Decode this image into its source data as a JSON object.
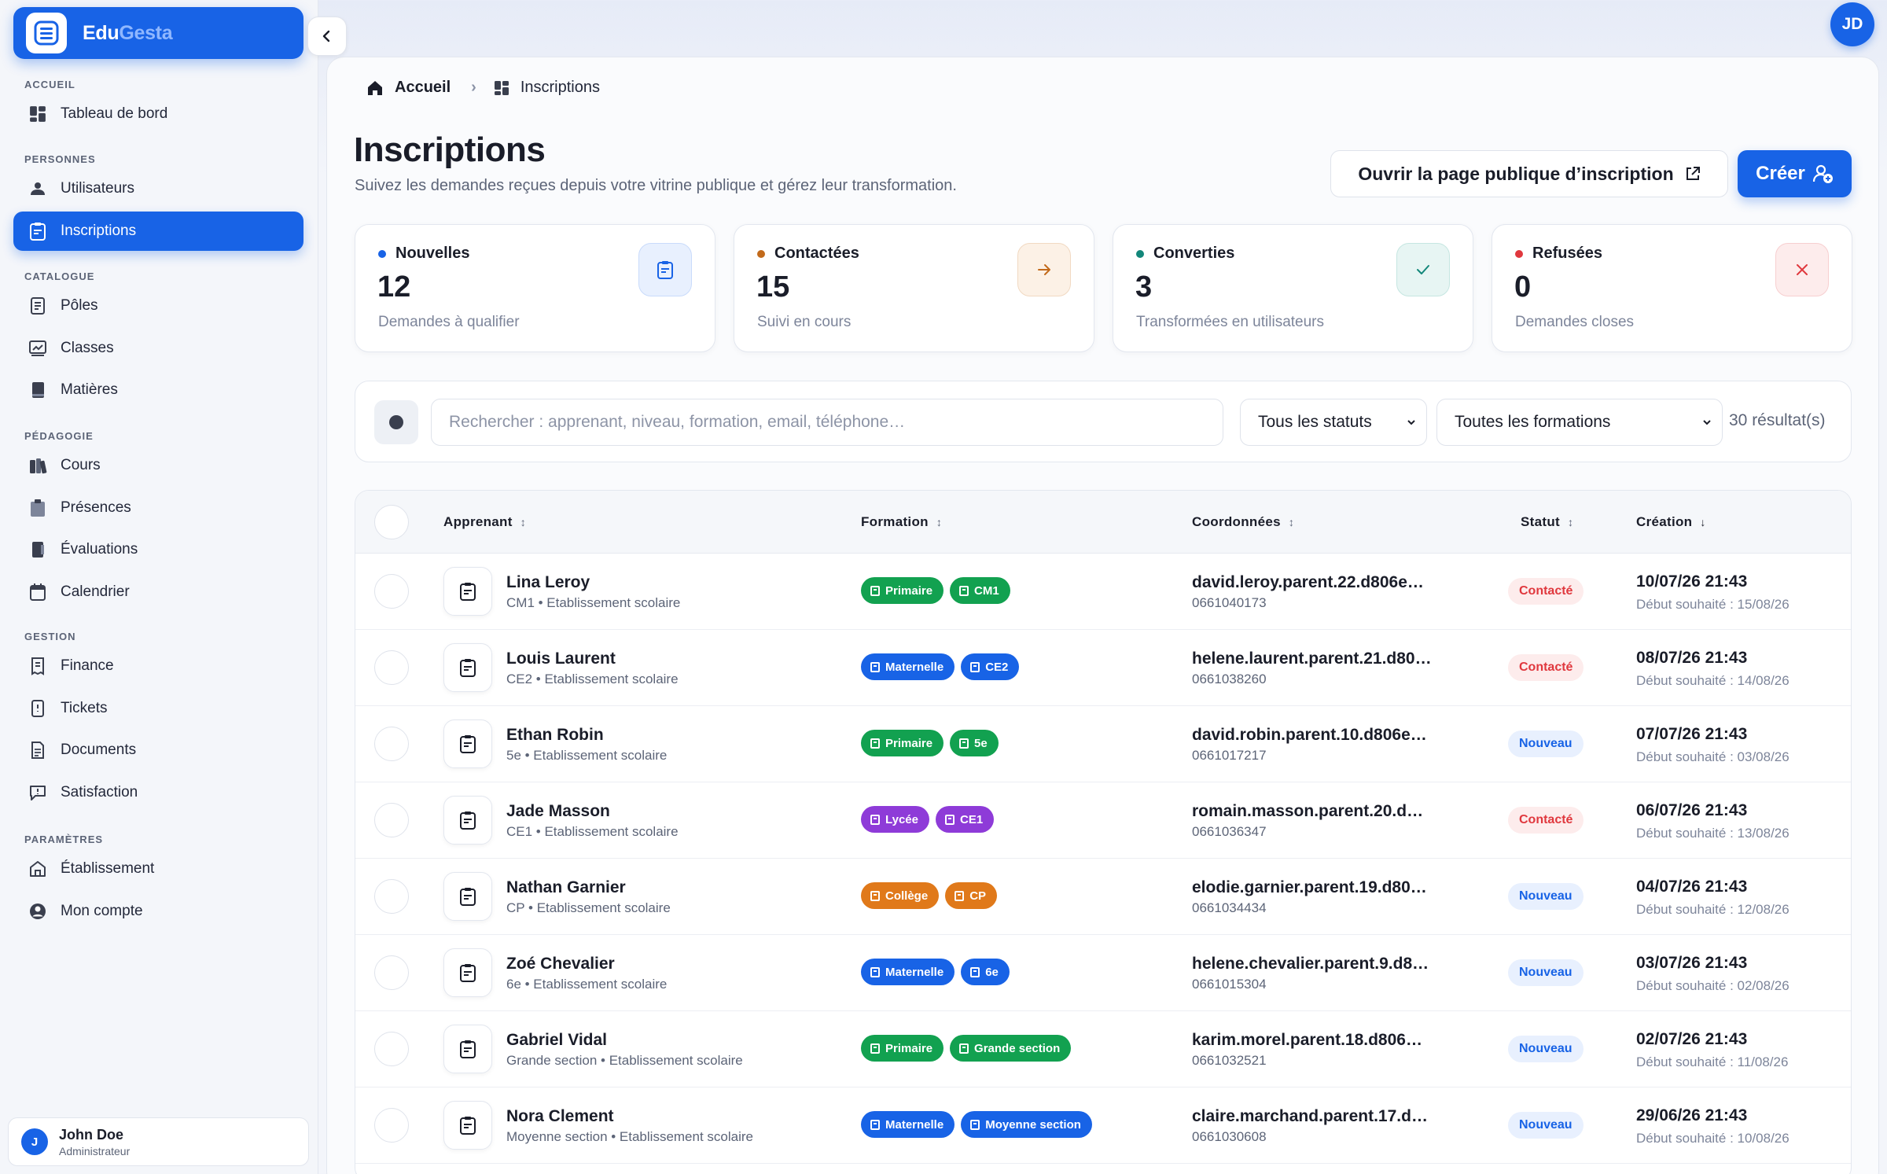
{
  "brand": {
    "name_part1": "Edu",
    "name_part2": "Gesta"
  },
  "top_avatar": "JD",
  "sidebar": {
    "sections": [
      {
        "label": "ACCUEIL",
        "items": [
          {
            "label": "Tableau de bord",
            "icon": "dashboard-icon"
          }
        ]
      },
      {
        "label": "PERSONNES",
        "items": [
          {
            "label": "Utilisateurs",
            "icon": "users-icon"
          },
          {
            "label": "Inscriptions",
            "icon": "clipboard-icon",
            "active": true
          }
        ]
      },
      {
        "label": "CATALOGUE",
        "items": [
          {
            "label": "Pôles",
            "icon": "document-icon"
          },
          {
            "label": "Classes",
            "icon": "classroom-icon"
          },
          {
            "label": "Matières",
            "icon": "book-icon"
          }
        ]
      },
      {
        "label": "PÉDAGOGIE",
        "items": [
          {
            "label": "Cours",
            "icon": "books-icon"
          },
          {
            "label": "Présences",
            "icon": "clipboard-check-icon"
          },
          {
            "label": "Évaluations",
            "icon": "notebook-icon"
          },
          {
            "label": "Calendrier",
            "icon": "calendar-icon"
          }
        ]
      },
      {
        "label": "GESTION",
        "items": [
          {
            "label": "Finance",
            "icon": "receipt-icon"
          },
          {
            "label": "Tickets",
            "icon": "ticket-icon"
          },
          {
            "label": "Documents",
            "icon": "file-icon"
          },
          {
            "label": "Satisfaction",
            "icon": "message-icon"
          }
        ]
      },
      {
        "label": "PARAMÈTRES",
        "items": [
          {
            "label": "Établissement",
            "icon": "building-icon"
          },
          {
            "label": "Mon compte",
            "icon": "account-icon"
          }
        ]
      }
    ],
    "user": {
      "initial": "J",
      "name": "John Doe",
      "role": "Administrateur"
    }
  },
  "breadcrumb": {
    "home": "Accueil",
    "current": "Inscriptions"
  },
  "page": {
    "title": "Inscriptions",
    "subtitle": "Suivez les demandes reçues depuis votre vitrine publique et gérez leur transformation."
  },
  "actions": {
    "public_page": "Ouvrir la page publique d’inscription",
    "create": "Créer"
  },
  "stats": [
    {
      "label": "Nouvelles",
      "value": "12",
      "desc": "Demandes à qualifier",
      "dot_color": "#1863e6",
      "icon": "clipboard-icon",
      "icon_color": "#1863e6",
      "icon_bg": "#e8f0fe",
      "icon_border": "#c9dbfb"
    },
    {
      "label": "Contactées",
      "value": "15",
      "desc": "Suivi en cours",
      "dot_color": "#c26a1b",
      "icon": "arrow-right-icon",
      "icon_color": "#c26a1b",
      "icon_bg": "#fcf1e6",
      "icon_border": "#f1d9c2"
    },
    {
      "label": "Converties",
      "value": "3",
      "desc": "Transformées en utilisateurs",
      "dot_color": "#13877a",
      "icon": "check-icon",
      "icon_color": "#13877a",
      "icon_bg": "#e7f5f3",
      "icon_border": "#c6e6e1"
    },
    {
      "label": "Refusées",
      "value": "0",
      "desc": "Demandes closes",
      "dot_color": "#e0383e",
      "icon": "close-icon",
      "icon_color": "#e0383e",
      "icon_bg": "#fdecec",
      "icon_border": "#f7cfd0"
    }
  ],
  "filters": {
    "search_placeholder": "Rechercher : apprenant, niveau, formation, email, téléphone…",
    "status_select": "Tous les statuts",
    "formation_select": "Toutes les formations",
    "result_count": "30 résultat(s)"
  },
  "table": {
    "headers": {
      "apprenant": "Apprenant",
      "formation": "Formation",
      "coordonnees": "Coordonnées",
      "statut": "Statut",
      "creation": "Création"
    },
    "rows": [
      {
        "name": "Lina Leroy",
        "sub": "CM1 • Etablissement scolaire",
        "tags": [
          {
            "label": "Primaire",
            "color": "#12a150"
          },
          {
            "label": "CM1",
            "color": "#12a150"
          }
        ],
        "email": "david.leroy.parent.22.d806e…",
        "phone": "0661040173",
        "status": "Contacté",
        "status_kind": "contacte",
        "date": "10/07/26 21:43",
        "desired": "Début souhaité : 15/08/26"
      },
      {
        "name": "Louis Laurent",
        "sub": "CE2 • Etablissement scolaire",
        "tags": [
          {
            "label": "Maternelle",
            "color": "#1863e6"
          },
          {
            "label": "CE2",
            "color": "#1863e6"
          }
        ],
        "email": "helene.laurent.parent.21.d80…",
        "phone": "0661038260",
        "status": "Contacté",
        "status_kind": "contacte",
        "date": "08/07/26 21:43",
        "desired": "Début souhaité : 14/08/26"
      },
      {
        "name": "Ethan Robin",
        "sub": "5e • Etablissement scolaire",
        "tags": [
          {
            "label": "Primaire",
            "color": "#12a150"
          },
          {
            "label": "5e",
            "color": "#12a150"
          }
        ],
        "email": "david.robin.parent.10.d806e…",
        "phone": "0661017217",
        "status": "Nouveau",
        "status_kind": "nouveau",
        "date": "07/07/26 21:43",
        "desired": "Début souhaité : 03/08/26"
      },
      {
        "name": "Jade Masson",
        "sub": "CE1 • Etablissement scolaire",
        "tags": [
          {
            "label": "Lycée",
            "color": "#8e3bd8"
          },
          {
            "label": "CE1",
            "color": "#8e3bd8"
          }
        ],
        "email": "romain.masson.parent.20.d…",
        "phone": "0661036347",
        "status": "Contacté",
        "status_kind": "contacte",
        "date": "06/07/26 21:43",
        "desired": "Début souhaité : 13/08/26"
      },
      {
        "name": "Nathan Garnier",
        "sub": "CP • Etablissement scolaire",
        "tags": [
          {
            "label": "Collège",
            "color": "#e0791a"
          },
          {
            "label": "CP",
            "color": "#e0791a"
          }
        ],
        "email": "elodie.garnier.parent.19.d80…",
        "phone": "0661034434",
        "status": "Nouveau",
        "status_kind": "nouveau",
        "date": "04/07/26 21:43",
        "desired": "Début souhaité : 12/08/26"
      },
      {
        "name": "Zoé Chevalier",
        "sub": "6e • Etablissement scolaire",
        "tags": [
          {
            "label": "Maternelle",
            "color": "#1863e6"
          },
          {
            "label": "6e",
            "color": "#1863e6"
          }
        ],
        "email": "helene.chevalier.parent.9.d8…",
        "phone": "0661015304",
        "status": "Nouveau",
        "status_kind": "nouveau",
        "date": "03/07/26 21:43",
        "desired": "Début souhaité : 02/08/26"
      },
      {
        "name": "Gabriel Vidal",
        "sub": "Grande section • Etablissement scolaire",
        "tags": [
          {
            "label": "Primaire",
            "color": "#12a150"
          },
          {
            "label": "Grande section",
            "color": "#12a150"
          }
        ],
        "email": "karim.morel.parent.18.d806…",
        "phone": "0661032521",
        "status": "Nouveau",
        "status_kind": "nouveau",
        "date": "02/07/26 21:43",
        "desired": "Début souhaité : 11/08/26"
      },
      {
        "name": "Nora Clement",
        "sub": "Moyenne section • Etablissement scolaire",
        "tags": [
          {
            "label": "Maternelle",
            "color": "#1863e6"
          },
          {
            "label": "Moyenne section",
            "color": "#1863e6"
          }
        ],
        "email": "claire.marchand.parent.17.d…",
        "phone": "0661030608",
        "status": "Nouveau",
        "status_kind": "nouveau",
        "date": "29/06/26 21:43",
        "desired": "Début souhaité : 10/08/26"
      }
    ]
  }
}
